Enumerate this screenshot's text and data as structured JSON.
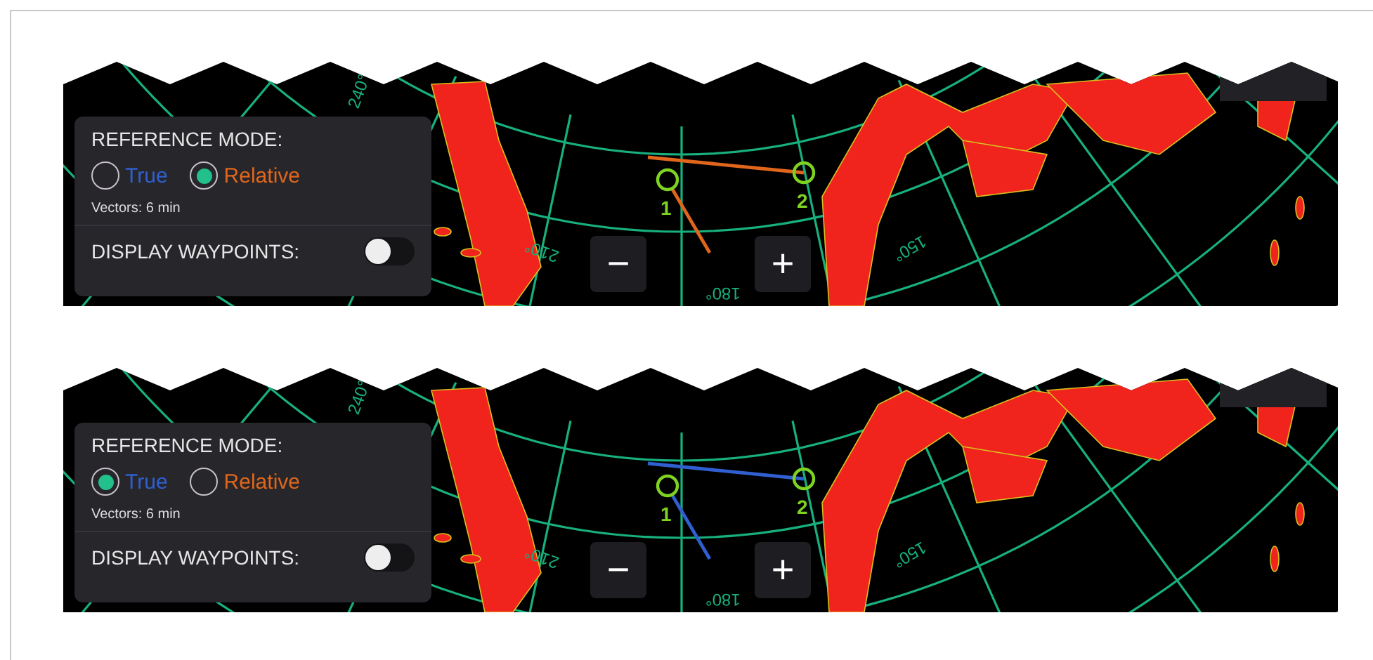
{
  "panels": [
    {
      "reference_mode": {
        "label": "REFERENCE MODE:",
        "options": [
          {
            "label": "True",
            "selected": false,
            "color": "#2f5fd0"
          },
          {
            "label": "Relative",
            "selected": true,
            "color": "#e0661c"
          }
        ],
        "vectors": "Vectors: 6 min"
      },
      "display_waypoints": {
        "label": "DISPLAY WAYPOINTS:",
        "on": false
      },
      "zoom_buttons": [
        "−",
        "+"
      ],
      "targets": [
        {
          "label": "1"
        },
        {
          "label": "2"
        }
      ],
      "bearings": [
        "240°",
        "210°",
        "180°",
        "150°"
      ]
    },
    {
      "reference_mode": {
        "label": "REFERENCE MODE:",
        "options": [
          {
            "label": "True",
            "selected": true,
            "color": "#2f5fd0"
          },
          {
            "label": "Relative",
            "selected": false,
            "color": "#e0661c"
          }
        ],
        "vectors": "Vectors: 6 min"
      },
      "display_waypoints": {
        "label": "DISPLAY WAYPOINTS:",
        "on": false
      },
      "zoom_buttons": [
        "−",
        "+"
      ],
      "targets": [
        {
          "label": "1"
        },
        {
          "label": "2"
        }
      ],
      "bearings": [
        "240°",
        "210°",
        "180°",
        "150°"
      ]
    }
  ]
}
